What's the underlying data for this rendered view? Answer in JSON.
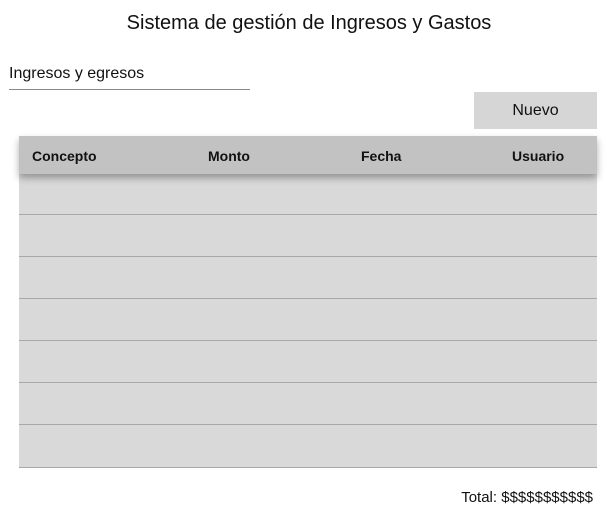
{
  "header": {
    "title": "Sistema de gestión de Ingresos y Gastos"
  },
  "section": {
    "tab_label": "Ingresos y egresos"
  },
  "toolbar": {
    "new_label": "Nuevo"
  },
  "table": {
    "columns": [
      "Concepto",
      "Monto",
      "Fecha",
      "Usuario"
    ],
    "rows": [
      [
        "",
        "",
        "",
        ""
      ],
      [
        "",
        "",
        "",
        ""
      ],
      [
        "",
        "",
        "",
        ""
      ],
      [
        "",
        "",
        "",
        ""
      ],
      [
        "",
        "",
        "",
        ""
      ],
      [
        "",
        "",
        "",
        ""
      ],
      [
        "",
        "",
        "",
        ""
      ]
    ]
  },
  "footer": {
    "total_label": "Total:",
    "total_value": "$$$$$$$$$$$"
  },
  "colors": {
    "button_bg": "#d6d6d6",
    "table_header_bg": "#c2c2c2",
    "table_body_bg": "#d9d9d9",
    "divider": "#a8a8a8"
  }
}
